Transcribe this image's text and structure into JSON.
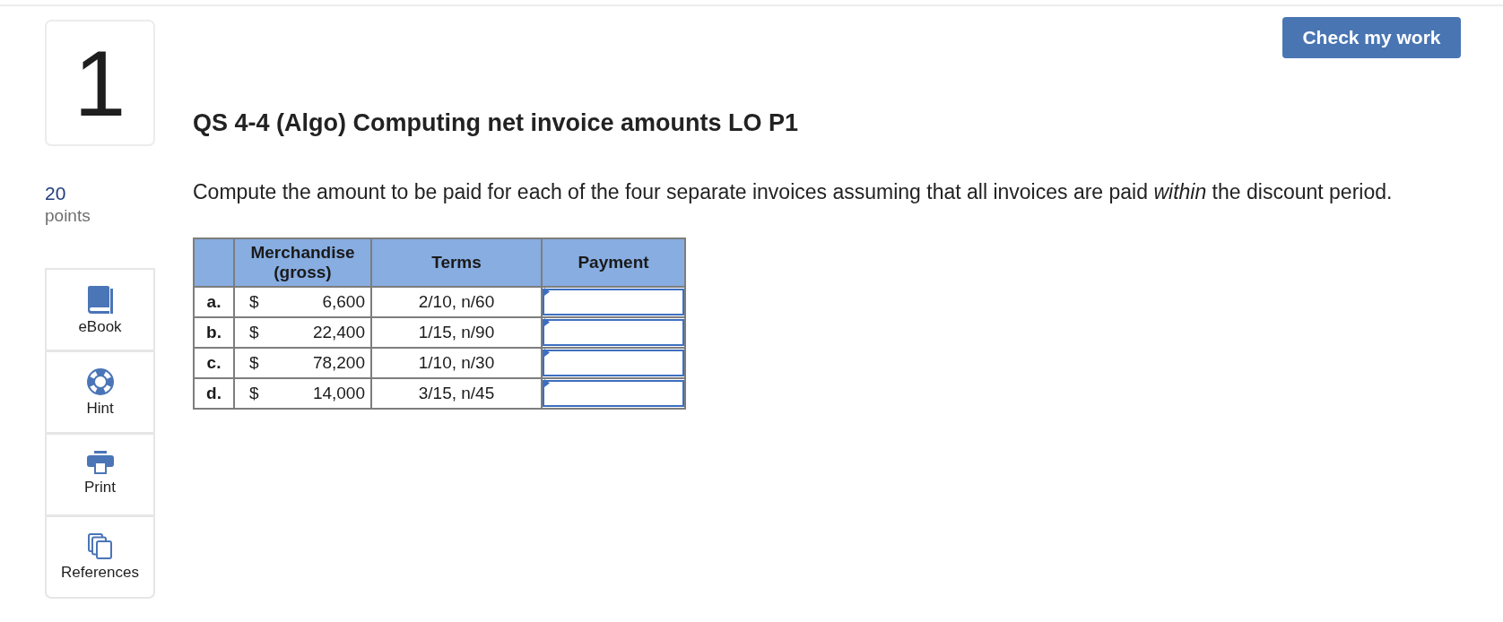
{
  "question": {
    "number": "1",
    "points_value": "20",
    "points_label": "points"
  },
  "tools": [
    {
      "kind": "ebook",
      "label": "eBook"
    },
    {
      "kind": "hint",
      "label": "Hint"
    },
    {
      "kind": "print",
      "label": "Print"
    },
    {
      "kind": "references",
      "label": "References"
    }
  ],
  "check_button": {
    "label": "Check my work"
  },
  "title": "QS 4-4 (Algo) Computing net invoice amounts LO P1",
  "instructions": "Compute the amount to be paid for each of the four separate invoices assuming that all invoices are paid *within* the discount period.",
  "table": {
    "columns": [
      {
        "label": "Merchandise (gross)"
      },
      {
        "label": "Terms"
      },
      {
        "label": "Payment"
      }
    ],
    "rows": [
      {
        "label": "a.",
        "currency": "$",
        "amount": "6,600",
        "terms": "2/10, n/60"
      },
      {
        "label": "b.",
        "currency": "$",
        "amount": "22,400",
        "terms": "1/15, n/90"
      },
      {
        "label": "c.",
        "currency": "$",
        "amount": "78,200",
        "terms": "1/10, n/30"
      },
      {
        "label": "d.",
        "currency": "$",
        "amount": "14,000",
        "terms": "3/15, n/45"
      }
    ]
  }
}
